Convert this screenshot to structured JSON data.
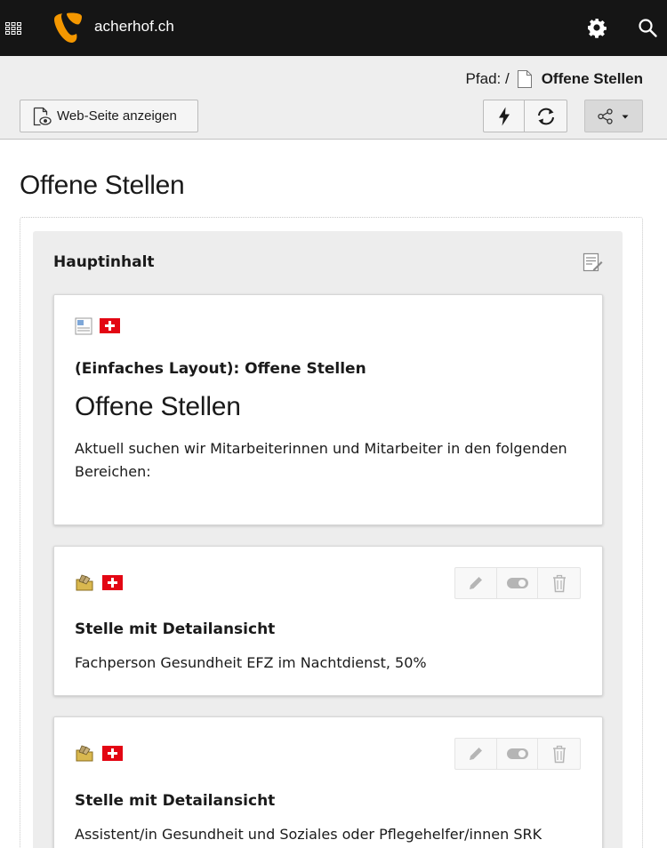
{
  "topbar": {
    "site_name": "acherhof.ch",
    "icons": [
      "app-grid-icon",
      "typo3-logo",
      "gear-icon",
      "search-icon"
    ]
  },
  "docheader": {
    "path_prefix": "Pfad: /",
    "path_title": "Offene Stellen",
    "view_button_label": "Web-Seite anzeigen"
  },
  "page": {
    "title": "Offene Stellen"
  },
  "column": {
    "title": "Hauptinhalt"
  },
  "elements": [
    {
      "type_label": "(Einfaches Layout): Offene Stellen",
      "header": "Offene Stellen",
      "body": "Aktuell suchen wir Mitarbeiterinnen und Mitarbeiter in den folgenden Bereichen:"
    },
    {
      "type_label": "Stelle mit Detailansicht",
      "body": "Fachperson Gesundheit EFZ im Nachtdienst, 50%"
    },
    {
      "type_label": "Stelle mit Detailansicht",
      "body": "Assistent/in Gesundheit und Soziales oder Pflegehelfer/innen SRK"
    }
  ],
  "colors": {
    "topbar_bg": "#151515",
    "logo_orange": "#f49700",
    "flag_red": "#e30613",
    "docheader_bg": "#eeeeee",
    "column_bg": "#ededed"
  }
}
